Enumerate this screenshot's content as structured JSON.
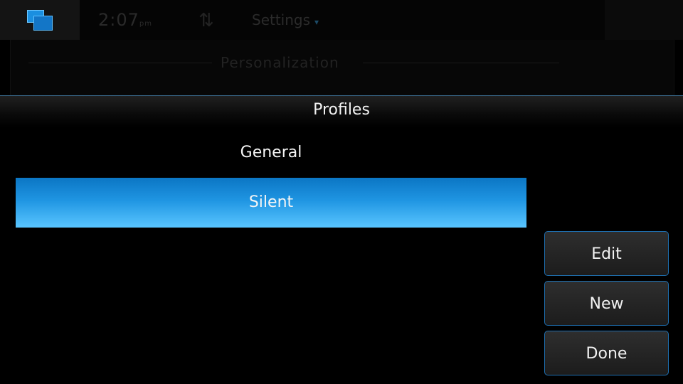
{
  "background": {
    "clock": "2:07",
    "clock_suffix": "pm",
    "title": "Settings",
    "title_caret": "▾",
    "section": "Personalization",
    "close_glyph": "✕",
    "network_glyph": "⇅",
    "icons": [
      "task-switcher-icon",
      "network-icon",
      "close-icon"
    ]
  },
  "dialog": {
    "title": "Profiles",
    "profiles": [
      {
        "label": "General",
        "selected": false
      },
      {
        "label": "Silent",
        "selected": true
      }
    ],
    "buttons": {
      "edit": "Edit",
      "new": "New",
      "done": "Done"
    }
  },
  "colors": {
    "accent": "#1f95e2",
    "selection_top": "#0b76c4",
    "selection_bottom": "#59c5ff",
    "button_border": "#1e6fb0",
    "background": "#000000"
  }
}
